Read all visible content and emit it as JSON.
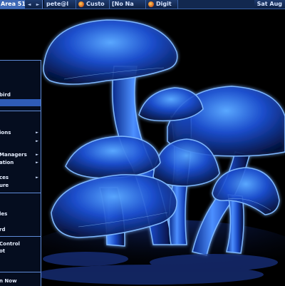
{
  "panel": {
    "workspace": "Area 51",
    "btn_left": "◄",
    "btn_right": "►",
    "tasks": [
      {
        "label": "pete@l",
        "icon": "terminal-icon"
      },
      {
        "label": "Custo",
        "icon": "firefox-icon"
      },
      {
        "label": "[No Na",
        "icon": "editor-icon"
      },
      {
        "label": "Digit",
        "icon": "camera-icon"
      }
    ],
    "clock": "Sat Aug"
  },
  "menu": {
    "items": [
      {
        "label": "bird",
        "selected": false,
        "arrow": false
      },
      {
        "label": "",
        "selected": true,
        "arrow": false
      },
      {
        "label": "ions",
        "selected": false,
        "arrow": true
      },
      {
        "label": "",
        "selected": false,
        "arrow": true
      },
      {
        "label": "Managers",
        "selected": false,
        "arrow": true
      },
      {
        "label": "ation",
        "selected": false,
        "arrow": true
      },
      {
        "label": "ces",
        "selected": false,
        "arrow": true
      },
      {
        "label": "ure",
        "selected": false,
        "arrow": false
      },
      {
        "label": "les",
        "selected": false,
        "arrow": false
      },
      {
        "label": "rd",
        "selected": false,
        "arrow": false
      },
      {
        "label": "Control",
        "selected": false,
        "arrow": false
      },
      {
        "label": "ot",
        "selected": false,
        "arrow": false
      },
      {
        "label": "n Now",
        "selected": false,
        "arrow": false
      }
    ]
  },
  "colors": {
    "panel": "#1e3a6e",
    "workspace": "#3d68b5",
    "menu_bg": "#050d1f",
    "menu_selected": "#2f5cb8",
    "mushroom_glow": "#3f8cff"
  },
  "wallpaper": {
    "subject": "glowing blue mushrooms"
  }
}
